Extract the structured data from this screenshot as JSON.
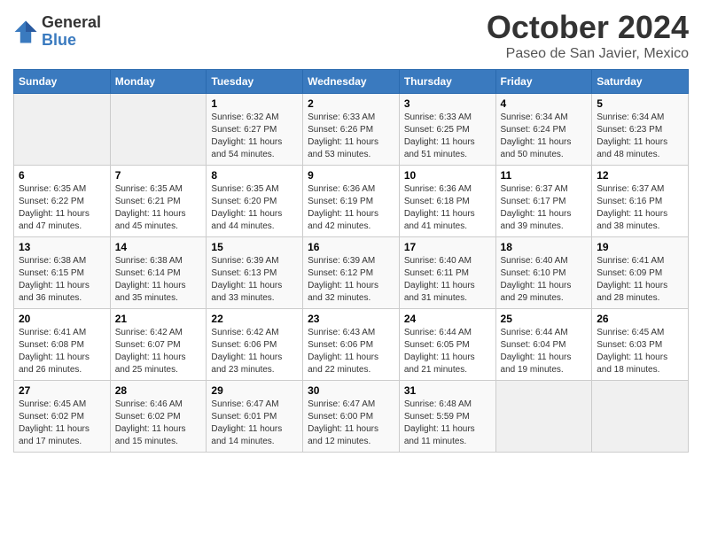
{
  "header": {
    "logo_general": "General",
    "logo_blue": "Blue",
    "month": "October 2024",
    "location": "Paseo de San Javier, Mexico"
  },
  "days_of_week": [
    "Sunday",
    "Monday",
    "Tuesday",
    "Wednesday",
    "Thursday",
    "Friday",
    "Saturday"
  ],
  "weeks": [
    [
      {
        "day": "",
        "sunrise": "",
        "sunset": "",
        "daylight": "",
        "empty": true
      },
      {
        "day": "",
        "sunrise": "",
        "sunset": "",
        "daylight": "",
        "empty": true
      },
      {
        "day": "1",
        "sunrise": "Sunrise: 6:32 AM",
        "sunset": "Sunset: 6:27 PM",
        "daylight": "Daylight: 11 hours and 54 minutes."
      },
      {
        "day": "2",
        "sunrise": "Sunrise: 6:33 AM",
        "sunset": "Sunset: 6:26 PM",
        "daylight": "Daylight: 11 hours and 53 minutes."
      },
      {
        "day": "3",
        "sunrise": "Sunrise: 6:33 AM",
        "sunset": "Sunset: 6:25 PM",
        "daylight": "Daylight: 11 hours and 51 minutes."
      },
      {
        "day": "4",
        "sunrise": "Sunrise: 6:34 AM",
        "sunset": "Sunset: 6:24 PM",
        "daylight": "Daylight: 11 hours and 50 minutes."
      },
      {
        "day": "5",
        "sunrise": "Sunrise: 6:34 AM",
        "sunset": "Sunset: 6:23 PM",
        "daylight": "Daylight: 11 hours and 48 minutes."
      }
    ],
    [
      {
        "day": "6",
        "sunrise": "Sunrise: 6:35 AM",
        "sunset": "Sunset: 6:22 PM",
        "daylight": "Daylight: 11 hours and 47 minutes."
      },
      {
        "day": "7",
        "sunrise": "Sunrise: 6:35 AM",
        "sunset": "Sunset: 6:21 PM",
        "daylight": "Daylight: 11 hours and 45 minutes."
      },
      {
        "day": "8",
        "sunrise": "Sunrise: 6:35 AM",
        "sunset": "Sunset: 6:20 PM",
        "daylight": "Daylight: 11 hours and 44 minutes."
      },
      {
        "day": "9",
        "sunrise": "Sunrise: 6:36 AM",
        "sunset": "Sunset: 6:19 PM",
        "daylight": "Daylight: 11 hours and 42 minutes."
      },
      {
        "day": "10",
        "sunrise": "Sunrise: 6:36 AM",
        "sunset": "Sunset: 6:18 PM",
        "daylight": "Daylight: 11 hours and 41 minutes."
      },
      {
        "day": "11",
        "sunrise": "Sunrise: 6:37 AM",
        "sunset": "Sunset: 6:17 PM",
        "daylight": "Daylight: 11 hours and 39 minutes."
      },
      {
        "day": "12",
        "sunrise": "Sunrise: 6:37 AM",
        "sunset": "Sunset: 6:16 PM",
        "daylight": "Daylight: 11 hours and 38 minutes."
      }
    ],
    [
      {
        "day": "13",
        "sunrise": "Sunrise: 6:38 AM",
        "sunset": "Sunset: 6:15 PM",
        "daylight": "Daylight: 11 hours and 36 minutes."
      },
      {
        "day": "14",
        "sunrise": "Sunrise: 6:38 AM",
        "sunset": "Sunset: 6:14 PM",
        "daylight": "Daylight: 11 hours and 35 minutes."
      },
      {
        "day": "15",
        "sunrise": "Sunrise: 6:39 AM",
        "sunset": "Sunset: 6:13 PM",
        "daylight": "Daylight: 11 hours and 33 minutes."
      },
      {
        "day": "16",
        "sunrise": "Sunrise: 6:39 AM",
        "sunset": "Sunset: 6:12 PM",
        "daylight": "Daylight: 11 hours and 32 minutes."
      },
      {
        "day": "17",
        "sunrise": "Sunrise: 6:40 AM",
        "sunset": "Sunset: 6:11 PM",
        "daylight": "Daylight: 11 hours and 31 minutes."
      },
      {
        "day": "18",
        "sunrise": "Sunrise: 6:40 AM",
        "sunset": "Sunset: 6:10 PM",
        "daylight": "Daylight: 11 hours and 29 minutes."
      },
      {
        "day": "19",
        "sunrise": "Sunrise: 6:41 AM",
        "sunset": "Sunset: 6:09 PM",
        "daylight": "Daylight: 11 hours and 28 minutes."
      }
    ],
    [
      {
        "day": "20",
        "sunrise": "Sunrise: 6:41 AM",
        "sunset": "Sunset: 6:08 PM",
        "daylight": "Daylight: 11 hours and 26 minutes."
      },
      {
        "day": "21",
        "sunrise": "Sunrise: 6:42 AM",
        "sunset": "Sunset: 6:07 PM",
        "daylight": "Daylight: 11 hours and 25 minutes."
      },
      {
        "day": "22",
        "sunrise": "Sunrise: 6:42 AM",
        "sunset": "Sunset: 6:06 PM",
        "daylight": "Daylight: 11 hours and 23 minutes."
      },
      {
        "day": "23",
        "sunrise": "Sunrise: 6:43 AM",
        "sunset": "Sunset: 6:06 PM",
        "daylight": "Daylight: 11 hours and 22 minutes."
      },
      {
        "day": "24",
        "sunrise": "Sunrise: 6:44 AM",
        "sunset": "Sunset: 6:05 PM",
        "daylight": "Daylight: 11 hours and 21 minutes."
      },
      {
        "day": "25",
        "sunrise": "Sunrise: 6:44 AM",
        "sunset": "Sunset: 6:04 PM",
        "daylight": "Daylight: 11 hours and 19 minutes."
      },
      {
        "day": "26",
        "sunrise": "Sunrise: 6:45 AM",
        "sunset": "Sunset: 6:03 PM",
        "daylight": "Daylight: 11 hours and 18 minutes."
      }
    ],
    [
      {
        "day": "27",
        "sunrise": "Sunrise: 6:45 AM",
        "sunset": "Sunset: 6:02 PM",
        "daylight": "Daylight: 11 hours and 17 minutes."
      },
      {
        "day": "28",
        "sunrise": "Sunrise: 6:46 AM",
        "sunset": "Sunset: 6:02 PM",
        "daylight": "Daylight: 11 hours and 15 minutes."
      },
      {
        "day": "29",
        "sunrise": "Sunrise: 6:47 AM",
        "sunset": "Sunset: 6:01 PM",
        "daylight": "Daylight: 11 hours and 14 minutes."
      },
      {
        "day": "30",
        "sunrise": "Sunrise: 6:47 AM",
        "sunset": "Sunset: 6:00 PM",
        "daylight": "Daylight: 11 hours and 12 minutes."
      },
      {
        "day": "31",
        "sunrise": "Sunrise: 6:48 AM",
        "sunset": "Sunset: 5:59 PM",
        "daylight": "Daylight: 11 hours and 11 minutes."
      },
      {
        "day": "",
        "sunrise": "",
        "sunset": "",
        "daylight": "",
        "empty": true
      },
      {
        "day": "",
        "sunrise": "",
        "sunset": "",
        "daylight": "",
        "empty": true
      }
    ]
  ]
}
